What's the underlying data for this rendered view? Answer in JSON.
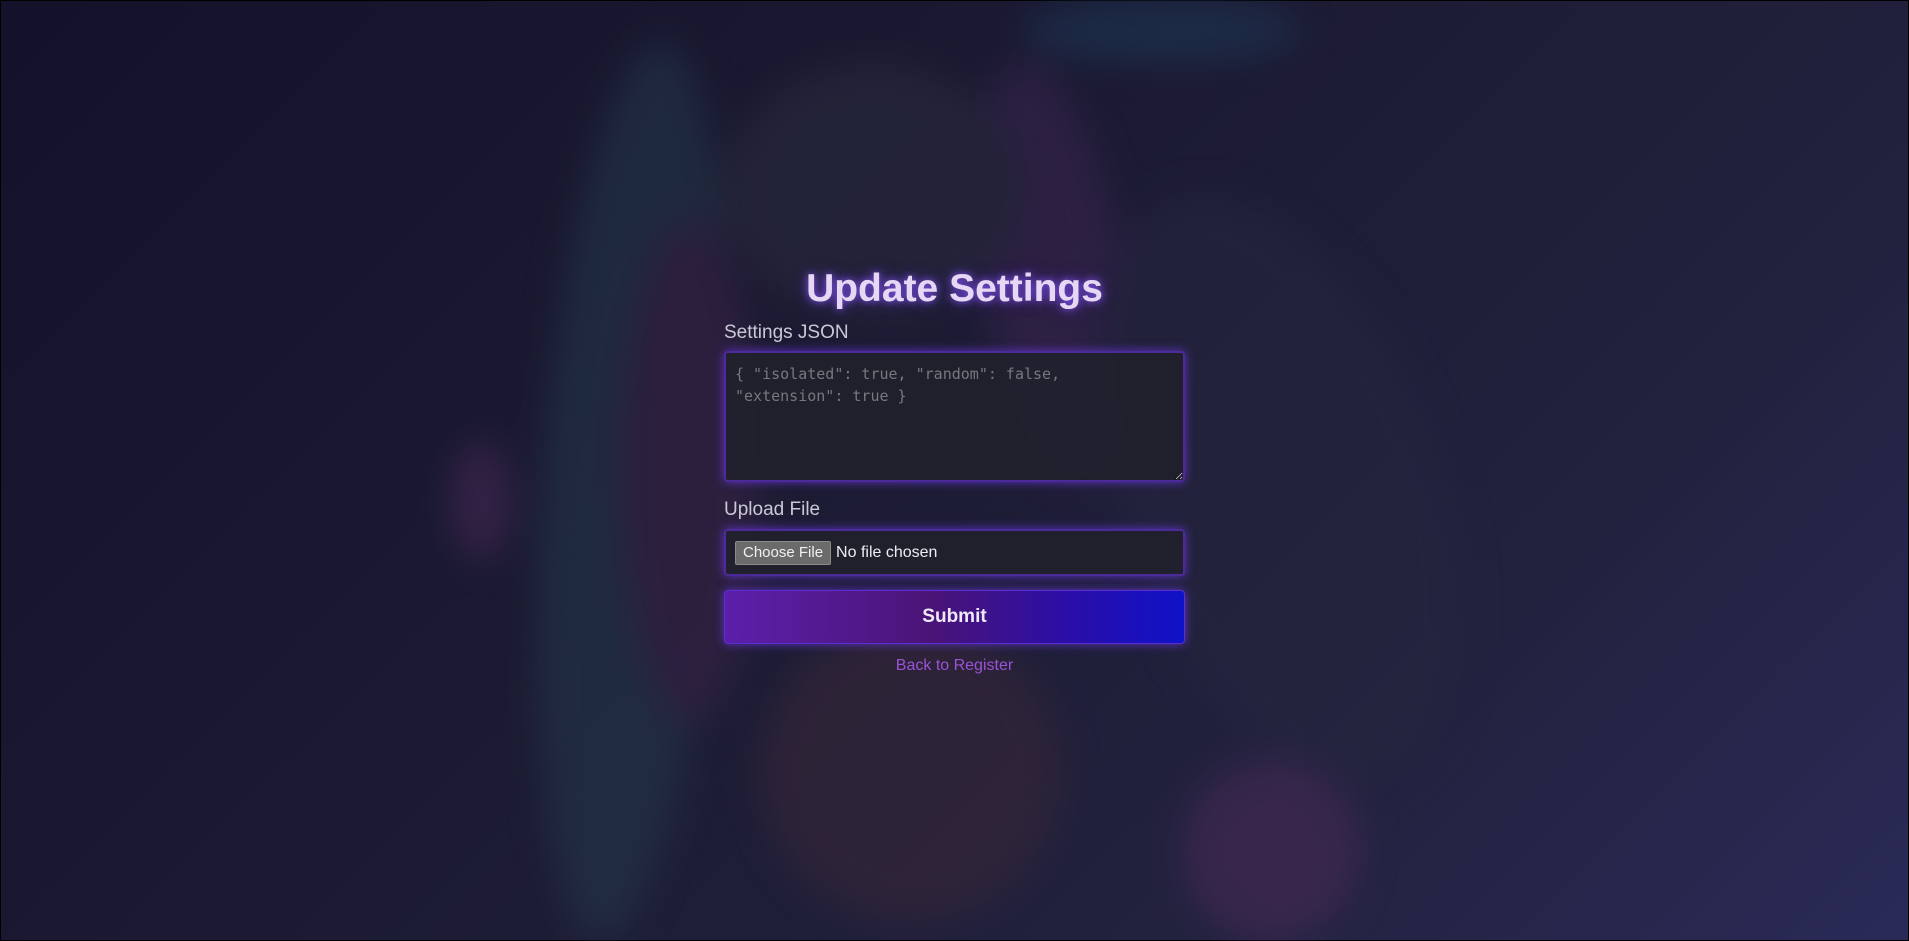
{
  "page": {
    "title": "Update Settings"
  },
  "form": {
    "settings_label": "Settings JSON",
    "settings_placeholder": "{ \"isolated\": true, \"random\": false, \"extension\": true }",
    "settings_value": "",
    "upload_label": "Upload File",
    "choose_file_label": "Choose File",
    "file_status": "No file chosen",
    "submit_label": "Submit"
  },
  "links": {
    "back_label": "Back to Register"
  },
  "colors": {
    "accent": "#9a52d8",
    "glow": "#7a3cff",
    "button_start": "#5b1faa",
    "button_end": "#0f12c8"
  }
}
